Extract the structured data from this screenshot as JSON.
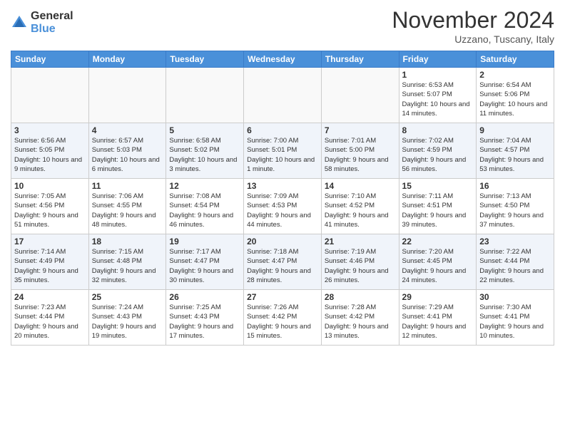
{
  "header": {
    "logo": {
      "general": "General",
      "blue": "Blue"
    },
    "title": "November 2024",
    "location": "Uzzano, Tuscany, Italy"
  },
  "weekdays": [
    "Sunday",
    "Monday",
    "Tuesday",
    "Wednesday",
    "Thursday",
    "Friday",
    "Saturday"
  ],
  "weeks": [
    [
      {
        "day": "",
        "sunrise": "",
        "sunset": "",
        "daylight": "",
        "empty": true
      },
      {
        "day": "",
        "sunrise": "",
        "sunset": "",
        "daylight": "",
        "empty": true
      },
      {
        "day": "",
        "sunrise": "",
        "sunset": "",
        "daylight": "",
        "empty": true
      },
      {
        "day": "",
        "sunrise": "",
        "sunset": "",
        "daylight": "",
        "empty": true
      },
      {
        "day": "",
        "sunrise": "",
        "sunset": "",
        "daylight": "",
        "empty": true
      },
      {
        "day": "1",
        "sunrise": "Sunrise: 6:53 AM",
        "sunset": "Sunset: 5:07 PM",
        "daylight": "Daylight: 10 hours and 14 minutes."
      },
      {
        "day": "2",
        "sunrise": "Sunrise: 6:54 AM",
        "sunset": "Sunset: 5:06 PM",
        "daylight": "Daylight: 10 hours and 11 minutes."
      }
    ],
    [
      {
        "day": "3",
        "sunrise": "Sunrise: 6:56 AM",
        "sunset": "Sunset: 5:05 PM",
        "daylight": "Daylight: 10 hours and 9 minutes."
      },
      {
        "day": "4",
        "sunrise": "Sunrise: 6:57 AM",
        "sunset": "Sunset: 5:03 PM",
        "daylight": "Daylight: 10 hours and 6 minutes."
      },
      {
        "day": "5",
        "sunrise": "Sunrise: 6:58 AM",
        "sunset": "Sunset: 5:02 PM",
        "daylight": "Daylight: 10 hours and 3 minutes."
      },
      {
        "day": "6",
        "sunrise": "Sunrise: 7:00 AM",
        "sunset": "Sunset: 5:01 PM",
        "daylight": "Daylight: 10 hours and 1 minute."
      },
      {
        "day": "7",
        "sunrise": "Sunrise: 7:01 AM",
        "sunset": "Sunset: 5:00 PM",
        "daylight": "Daylight: 9 hours and 58 minutes."
      },
      {
        "day": "8",
        "sunrise": "Sunrise: 7:02 AM",
        "sunset": "Sunset: 4:59 PM",
        "daylight": "Daylight: 9 hours and 56 minutes."
      },
      {
        "day": "9",
        "sunrise": "Sunrise: 7:04 AM",
        "sunset": "Sunset: 4:57 PM",
        "daylight": "Daylight: 9 hours and 53 minutes."
      }
    ],
    [
      {
        "day": "10",
        "sunrise": "Sunrise: 7:05 AM",
        "sunset": "Sunset: 4:56 PM",
        "daylight": "Daylight: 9 hours and 51 minutes."
      },
      {
        "day": "11",
        "sunrise": "Sunrise: 7:06 AM",
        "sunset": "Sunset: 4:55 PM",
        "daylight": "Daylight: 9 hours and 48 minutes."
      },
      {
        "day": "12",
        "sunrise": "Sunrise: 7:08 AM",
        "sunset": "Sunset: 4:54 PM",
        "daylight": "Daylight: 9 hours and 46 minutes."
      },
      {
        "day": "13",
        "sunrise": "Sunrise: 7:09 AM",
        "sunset": "Sunset: 4:53 PM",
        "daylight": "Daylight: 9 hours and 44 minutes."
      },
      {
        "day": "14",
        "sunrise": "Sunrise: 7:10 AM",
        "sunset": "Sunset: 4:52 PM",
        "daylight": "Daylight: 9 hours and 41 minutes."
      },
      {
        "day": "15",
        "sunrise": "Sunrise: 7:11 AM",
        "sunset": "Sunset: 4:51 PM",
        "daylight": "Daylight: 9 hours and 39 minutes."
      },
      {
        "day": "16",
        "sunrise": "Sunrise: 7:13 AM",
        "sunset": "Sunset: 4:50 PM",
        "daylight": "Daylight: 9 hours and 37 minutes."
      }
    ],
    [
      {
        "day": "17",
        "sunrise": "Sunrise: 7:14 AM",
        "sunset": "Sunset: 4:49 PM",
        "daylight": "Daylight: 9 hours and 35 minutes."
      },
      {
        "day": "18",
        "sunrise": "Sunrise: 7:15 AM",
        "sunset": "Sunset: 4:48 PM",
        "daylight": "Daylight: 9 hours and 32 minutes."
      },
      {
        "day": "19",
        "sunrise": "Sunrise: 7:17 AM",
        "sunset": "Sunset: 4:47 PM",
        "daylight": "Daylight: 9 hours and 30 minutes."
      },
      {
        "day": "20",
        "sunrise": "Sunrise: 7:18 AM",
        "sunset": "Sunset: 4:47 PM",
        "daylight": "Daylight: 9 hours and 28 minutes."
      },
      {
        "day": "21",
        "sunrise": "Sunrise: 7:19 AM",
        "sunset": "Sunset: 4:46 PM",
        "daylight": "Daylight: 9 hours and 26 minutes."
      },
      {
        "day": "22",
        "sunrise": "Sunrise: 7:20 AM",
        "sunset": "Sunset: 4:45 PM",
        "daylight": "Daylight: 9 hours and 24 minutes."
      },
      {
        "day": "23",
        "sunrise": "Sunrise: 7:22 AM",
        "sunset": "Sunset: 4:44 PM",
        "daylight": "Daylight: 9 hours and 22 minutes."
      }
    ],
    [
      {
        "day": "24",
        "sunrise": "Sunrise: 7:23 AM",
        "sunset": "Sunset: 4:44 PM",
        "daylight": "Daylight: 9 hours and 20 minutes."
      },
      {
        "day": "25",
        "sunrise": "Sunrise: 7:24 AM",
        "sunset": "Sunset: 4:43 PM",
        "daylight": "Daylight: 9 hours and 19 minutes."
      },
      {
        "day": "26",
        "sunrise": "Sunrise: 7:25 AM",
        "sunset": "Sunset: 4:43 PM",
        "daylight": "Daylight: 9 hours and 17 minutes."
      },
      {
        "day": "27",
        "sunrise": "Sunrise: 7:26 AM",
        "sunset": "Sunset: 4:42 PM",
        "daylight": "Daylight: 9 hours and 15 minutes."
      },
      {
        "day": "28",
        "sunrise": "Sunrise: 7:28 AM",
        "sunset": "Sunset: 4:42 PM",
        "daylight": "Daylight: 9 hours and 13 minutes."
      },
      {
        "day": "29",
        "sunrise": "Sunrise: 7:29 AM",
        "sunset": "Sunset: 4:41 PM",
        "daylight": "Daylight: 9 hours and 12 minutes."
      },
      {
        "day": "30",
        "sunrise": "Sunrise: 7:30 AM",
        "sunset": "Sunset: 4:41 PM",
        "daylight": "Daylight: 9 hours and 10 minutes."
      }
    ]
  ]
}
